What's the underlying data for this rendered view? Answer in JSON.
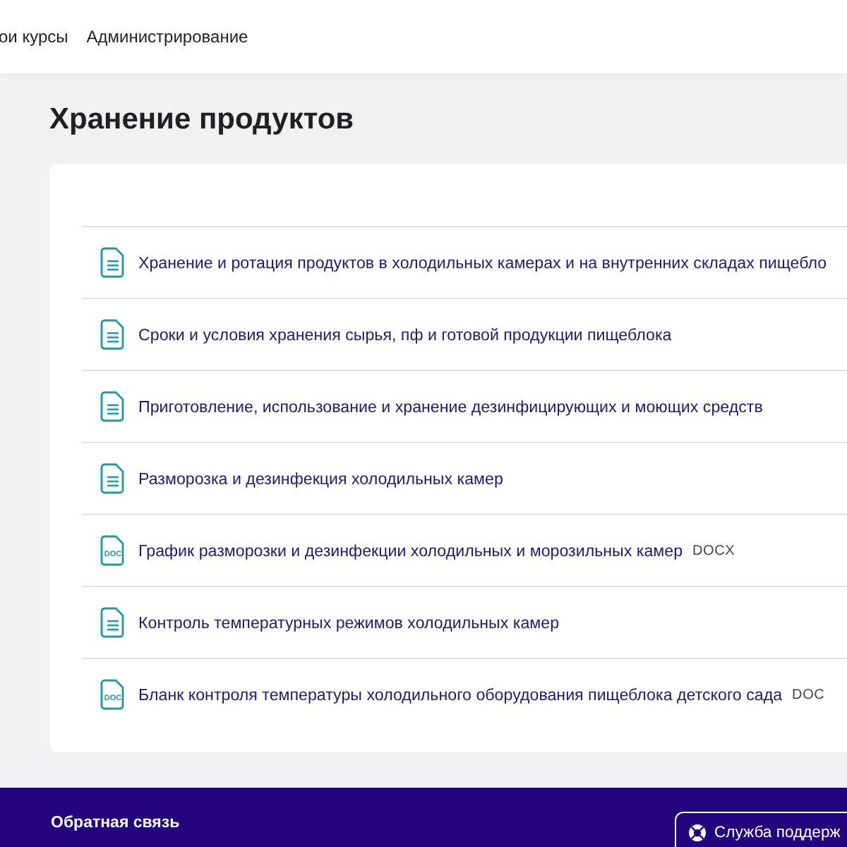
{
  "nav": {
    "items": [
      "ои курсы",
      "Администрирование"
    ]
  },
  "page_title": "Хранение продуктов",
  "resources": [
    {
      "kind": "file",
      "title": "Хранение и ротация продуктов в холодильных камерах и на внутренних складах пищебло"
    },
    {
      "kind": "file",
      "title": "Сроки и условия хранения сырья, пф и готовой продукции пищеблока"
    },
    {
      "kind": "file",
      "title": "Приготовление, использование и хранение дезинфицирующих и моющих средств"
    },
    {
      "kind": "file",
      "title": "Разморозка и дезинфекция холодильных камер"
    },
    {
      "kind": "doc",
      "icon_label": "DOC",
      "title": "График разморозки и дезинфекции холодильных и морозильных камер",
      "format": "DOCX"
    },
    {
      "kind": "file",
      "title": "Контроль температурных режимов холодильных камер"
    },
    {
      "kind": "doc",
      "icon_label": "DOC",
      "title": "Бланк контроля температуры холодильного оборудования пищеблока детского сада",
      "format": "DOC"
    }
  ],
  "footer": {
    "feedback": "Обратная связь",
    "support_button": "Служба поддерж"
  }
}
